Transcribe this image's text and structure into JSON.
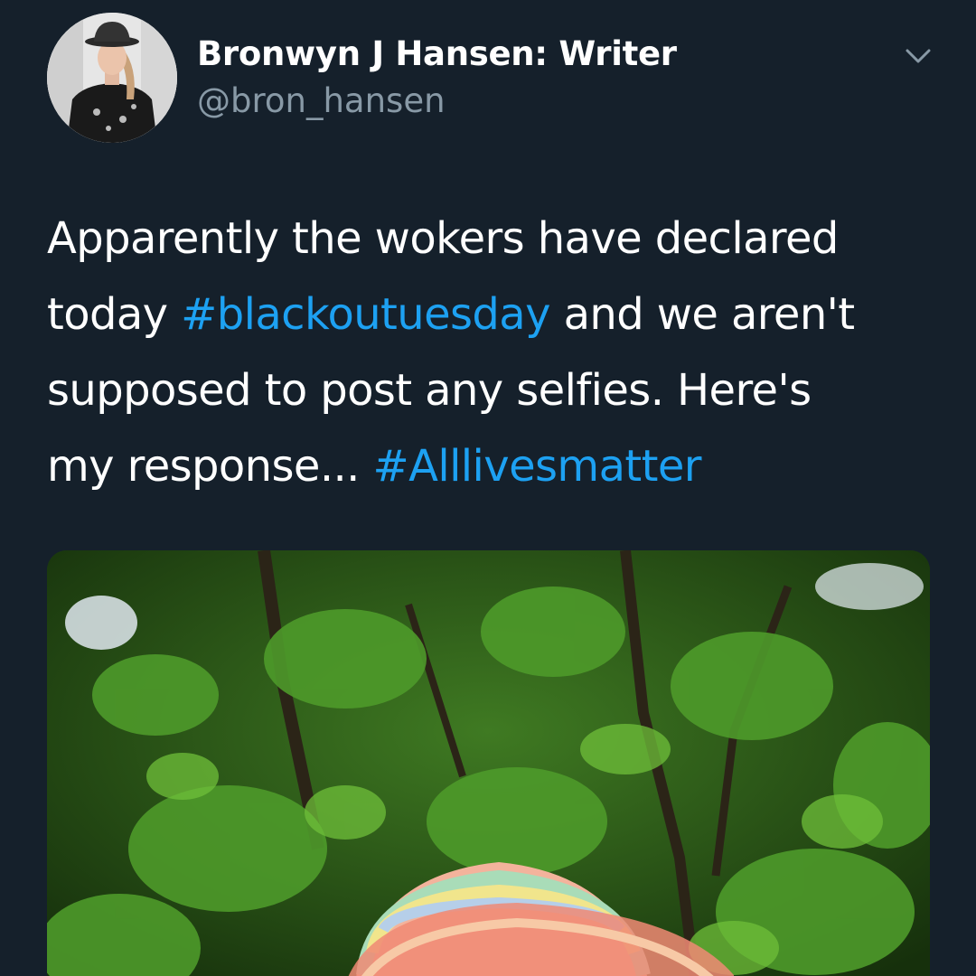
{
  "tweet": {
    "author": {
      "display_name": "Bronwyn J Hansen: Writer",
      "handle": "@bron_hansen",
      "avatar_icon": "profile-photo"
    },
    "menu_icon": "chevron-down-icon",
    "text_segments": [
      {
        "text": "Apparently the wokers have declared"
      },
      {
        "text": "today "
      },
      {
        "text": "#blackoutuesday"
      },
      {
        "text": " and we aren't"
      },
      {
        "text": "supposed to post any selfies. Here's"
      },
      {
        "text": "my response... "
      },
      {
        "text": "#Alllivesmatter"
      }
    ],
    "hashtags": [
      "#blackoutuesday",
      "#Alllivesmatter"
    ],
    "media": {
      "description_icon": "photo-trees-rainbow-crochet-hat"
    }
  },
  "colors": {
    "background": "#15202b",
    "text": "#ffffff",
    "secondary_text": "#8899a6",
    "link": "#1da1f2"
  }
}
